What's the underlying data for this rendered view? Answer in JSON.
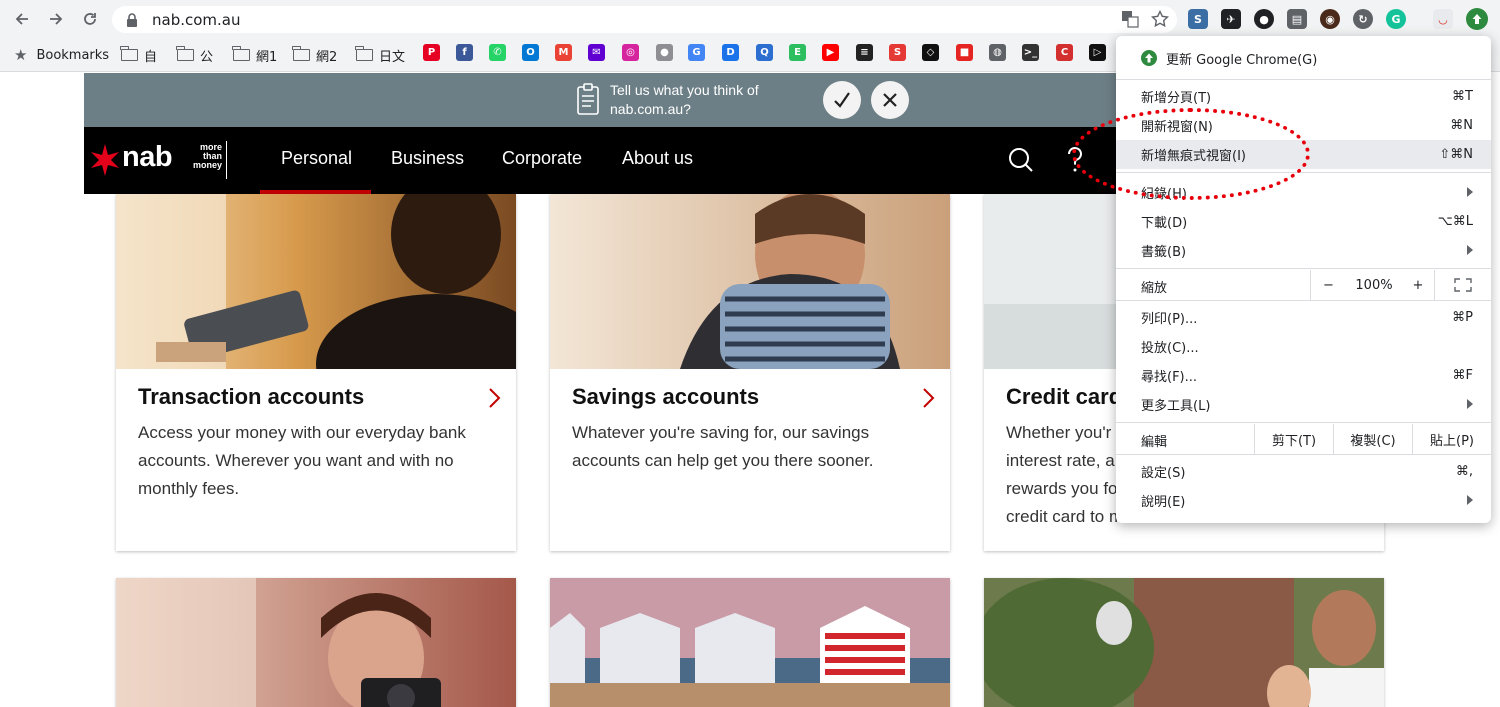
{
  "browser": {
    "url": "nab.com.au",
    "bookmarks_label": "Bookmarks",
    "bookmark_folders": [
      "自",
      "公",
      "網1",
      "網2",
      "日文"
    ],
    "favicons": [
      {
        "name": "pinterest",
        "letter": "P",
        "color": "#e60023"
      },
      {
        "name": "facebook",
        "letter": "f",
        "color": "#3b5998"
      },
      {
        "name": "whatsapp",
        "letter": "✆",
        "color": "#25d366"
      },
      {
        "name": "outlook",
        "letter": "O",
        "color": "#0078d4"
      },
      {
        "name": "gmail",
        "letter": "M",
        "color": "#ea4335"
      },
      {
        "name": "yahoo-mail",
        "letter": "✉",
        "color": "#6001d2"
      },
      {
        "name": "instagram",
        "letter": "◎",
        "color": "#d6249f"
      },
      {
        "name": "apple",
        "letter": "●",
        "color": "#8e8e93"
      },
      {
        "name": "translate",
        "letter": "G",
        "color": "#4285f4"
      },
      {
        "name": "dict",
        "letter": "D",
        "color": "#1a73e8"
      },
      {
        "name": "quora",
        "letter": "Q",
        "color": "#2c6fd1"
      },
      {
        "name": "evernote",
        "letter": "E",
        "color": "#2dbe60"
      },
      {
        "name": "youtube",
        "letter": "▶",
        "color": "#ff0000"
      },
      {
        "name": "notes",
        "letter": "≡",
        "color": "#222222"
      },
      {
        "name": "shopping",
        "letter": "S",
        "color": "#e53935"
      },
      {
        "name": "codepen",
        "letter": "◇",
        "color": "#111111"
      },
      {
        "name": "figma-red",
        "letter": "■",
        "color": "#e52521"
      },
      {
        "name": "globe",
        "letter": "◍",
        "color": "#5f6368"
      },
      {
        "name": "terminal",
        "letter": ">_",
        "color": "#333333"
      },
      {
        "name": "c-site",
        "letter": "C",
        "color": "#d32f2f"
      },
      {
        "name": "play",
        "letter": "▷",
        "color": "#111111"
      }
    ]
  },
  "feedback": {
    "line1": "Tell us what you think of",
    "line2": "nab.com.au?"
  },
  "nav": {
    "logo": "nab",
    "tagline": [
      "more",
      "than",
      "money"
    ],
    "items": [
      "Personal",
      "Business",
      "Corporate",
      "About us"
    ]
  },
  "cards": [
    {
      "title": "Transaction accounts",
      "desc": "Access your money with our everyday bank accounts. Wherever you want and with no monthly fees."
    },
    {
      "title": "Savings accounts",
      "desc": "Whatever you're saving for, our savings accounts can help get you there sooner."
    },
    {
      "title": "Credit card",
      "desc_lines": [
        "Whether you'r",
        "interest rate, a",
        "rewards you fo",
        "credit card to m"
      ]
    }
  ],
  "menu": {
    "update": "更新 Google Chrome(G)",
    "items_top": [
      {
        "label": "新增分頁(T)",
        "shortcut": "⌘T"
      },
      {
        "label": "開新視窗(N)",
        "shortcut": "⌘N"
      },
      {
        "label": "新增無痕式視窗(I)",
        "shortcut": "⇧⌘N"
      }
    ],
    "history": "紀錄(H)",
    "downloads": {
      "label": "下載(D)",
      "shortcut": "⌥⌘L"
    },
    "bookmarks": "書籤(B)",
    "zoom": {
      "label": "縮放",
      "minus": "−",
      "value": "100%",
      "plus": "+"
    },
    "print": {
      "label": "列印(P)...",
      "shortcut": "⌘P"
    },
    "cast": "投放(C)...",
    "find": {
      "label": "尋找(F)...",
      "shortcut": "⌘F"
    },
    "more_tools": "更多工具(L)",
    "edit": {
      "label": "編輯",
      "cut": "剪下(T)",
      "copy": "複製(C)",
      "paste": "貼上(P)"
    },
    "settings": {
      "label": "設定(S)",
      "shortcut": "⌘,"
    },
    "help": "說明(E)"
  },
  "colors": {
    "brand_red": "#c20000",
    "annotation": "#e8000b",
    "feedback_bg": "#6d7f86"
  }
}
